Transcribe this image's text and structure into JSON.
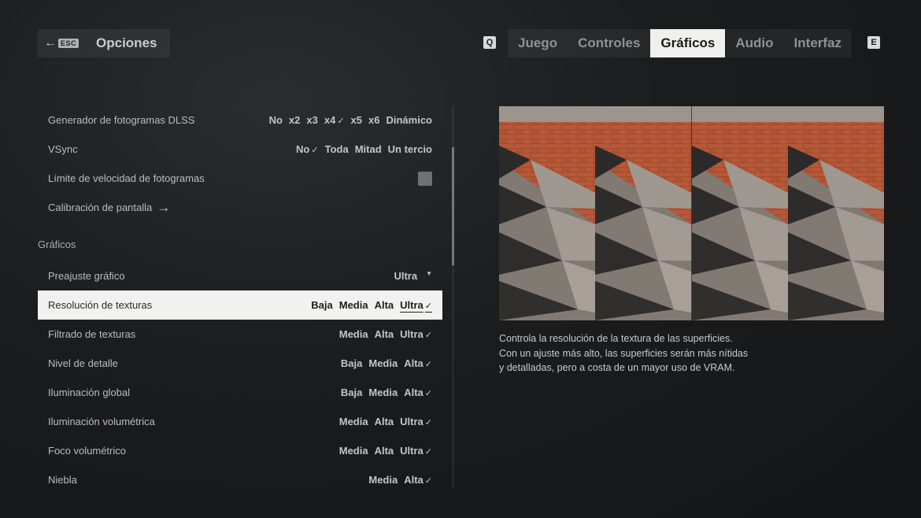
{
  "header": {
    "back_key": "ESC",
    "title": "Opciones",
    "prev_key": "Q",
    "next_key": "E",
    "tabs": [
      {
        "label": "Juego"
      },
      {
        "label": "Controles"
      },
      {
        "label": "Gráficos",
        "active": true
      },
      {
        "label": "Audio"
      },
      {
        "label": "Interfaz"
      }
    ]
  },
  "settings": {
    "dlss": {
      "label": "Generador de fotogramas DLSS",
      "options": [
        "No",
        "x2",
        "x3",
        "x4",
        "x5",
        "x6",
        "Dinámico"
      ],
      "selected": "x4"
    },
    "vsync": {
      "label": "VSync",
      "options": [
        "No",
        "Toda",
        "Mitad",
        "Un tercio"
      ],
      "selected": "No"
    },
    "fps_limit": {
      "label": "Límite de velocidad de fotogramas",
      "enabled": false
    },
    "calibration": {
      "label": "Calibración de pantalla"
    },
    "section_graphics": "Gráficos",
    "preset": {
      "label": "Preajuste gráfico",
      "value": "Ultra"
    },
    "texture_res": {
      "label": "Resolución de texturas",
      "options": [
        "Baja",
        "Media",
        "Alta",
        "Ultra"
      ],
      "selected": "Ultra"
    },
    "texture_filter": {
      "label": "Filtrado de texturas",
      "options": [
        "Media",
        "Alta",
        "Ultra"
      ],
      "selected": "Ultra"
    },
    "detail": {
      "label": "Nivel de detalle",
      "options": [
        "Baja",
        "Media",
        "Alta"
      ],
      "selected": "Alta"
    },
    "global_illum": {
      "label": "Iluminación global",
      "options": [
        "Baja",
        "Media",
        "Alta"
      ],
      "selected": "Alta"
    },
    "vol_illum": {
      "label": "Iluminación volumétrica",
      "options": [
        "Media",
        "Alta",
        "Ultra"
      ],
      "selected": "Ultra"
    },
    "vol_spot": {
      "label": "Foco volumétrico",
      "options": [
        "Media",
        "Alta",
        "Ultra"
      ],
      "selected": "Ultra"
    },
    "fog": {
      "label": "Niebla",
      "options": [
        "Media",
        "Alta"
      ],
      "selected": "Alta"
    }
  },
  "description": {
    "line1": "Controla la resolución de la textura de las superficies.",
    "line2": "Con un ajuste más alto, las superficies serán más nítidas",
    "line3": "y detalladas, pero a costa de un mayor uso de VRAM."
  },
  "colors": {
    "selected_row_bg": "#f1f1ef",
    "active_tab_bg": "#f0f0ee",
    "brick": "#b0522f",
    "concrete": "#8a8580"
  }
}
